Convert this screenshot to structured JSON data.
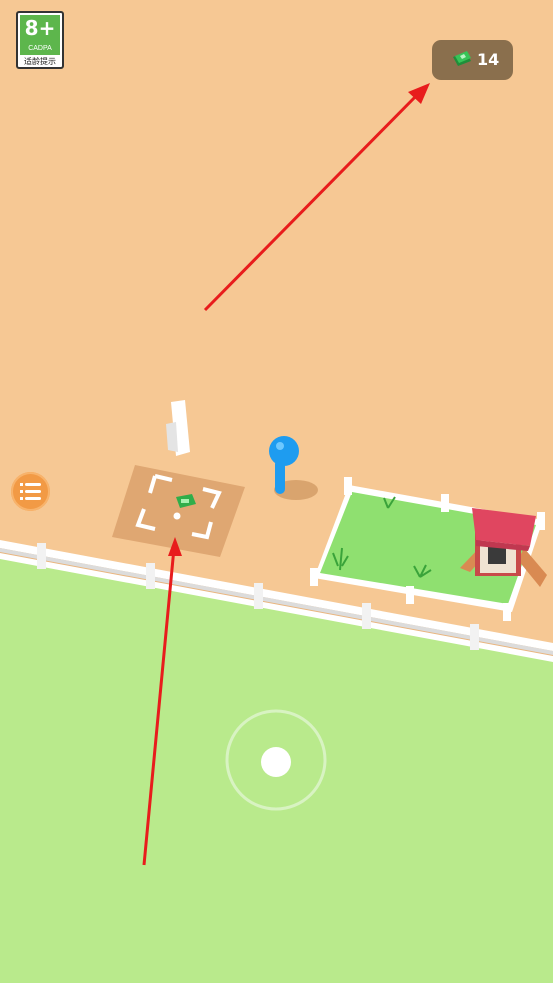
{
  "age_rating": {
    "number": "8+",
    "org": "CADPA",
    "hint": "适龄提示"
  },
  "currency": {
    "icon": "cash-icon",
    "value": "14"
  },
  "controls": {
    "menu_icon": "list-icon",
    "joystick": "virtual-joystick"
  },
  "colors": {
    "ground_sand": "#f6c894",
    "grass": "#b9ea8c",
    "pen_grass": "#8fe070",
    "coop_roof": "#e04660",
    "player": "#1e9cf0",
    "arrow": "#e81c1c",
    "currency_bg": "#8a6f4d"
  }
}
